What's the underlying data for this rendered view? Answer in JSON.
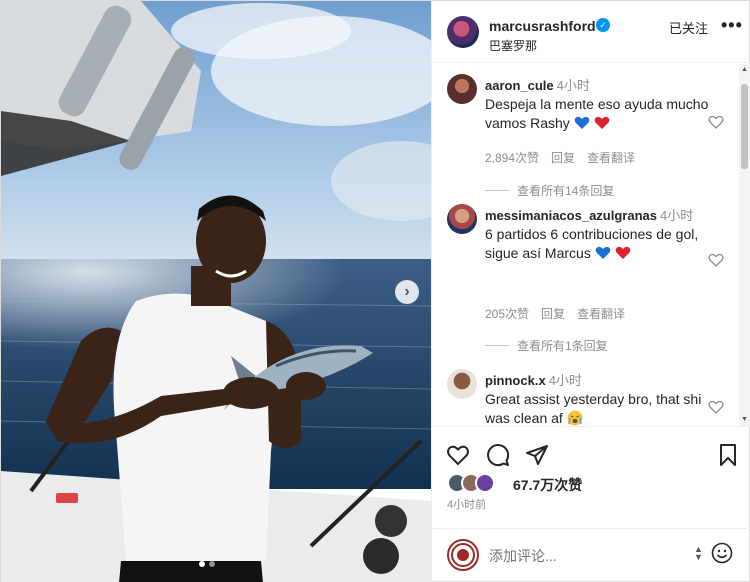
{
  "post": {
    "username": "marcusrashford",
    "location": "巴塞罗那",
    "follow_label": "已关注",
    "more_label": "•••",
    "likes": "67.7万次赞",
    "time": "4小时前",
    "carousel_next": "›"
  },
  "comments": [
    {
      "user": "aaron_cule",
      "time": "4小时",
      "text": "Despeja la mente eso ayuda mucho vamos Rashy",
      "emojis": [
        "blue-heart",
        "red-heart"
      ],
      "likes": "2,894次赞",
      "reply": "回复",
      "translate": "查看翻译",
      "view_replies": "查看所有14条回复"
    },
    {
      "user": "messimaniacos_azulgranas",
      "time": "4小时",
      "text": "6 partidos 6 contribuciones de gol, sigue así Marcus",
      "emojis": [
        "blue-heart",
        "red-heart"
      ],
      "likes": "205次赞",
      "reply": "回复",
      "translate": "查看翻译",
      "view_replies": "查看所有1条回复"
    },
    {
      "user": "pinnock.x",
      "time": "4小时",
      "text": "Great assist yesterday bro, that shi was clean af",
      "emojis": [
        "crying-face"
      ]
    }
  ],
  "comment_input": {
    "placeholder": "添加评论..."
  },
  "colors": {
    "verified": "#0095f6",
    "secondary_text": "#8e8e8e",
    "primary_text": "#262626"
  },
  "icons": [
    "heart-icon",
    "comment-icon",
    "share-icon",
    "bookmark-icon",
    "emoji-icon",
    "verified-icon",
    "more-icon"
  ]
}
